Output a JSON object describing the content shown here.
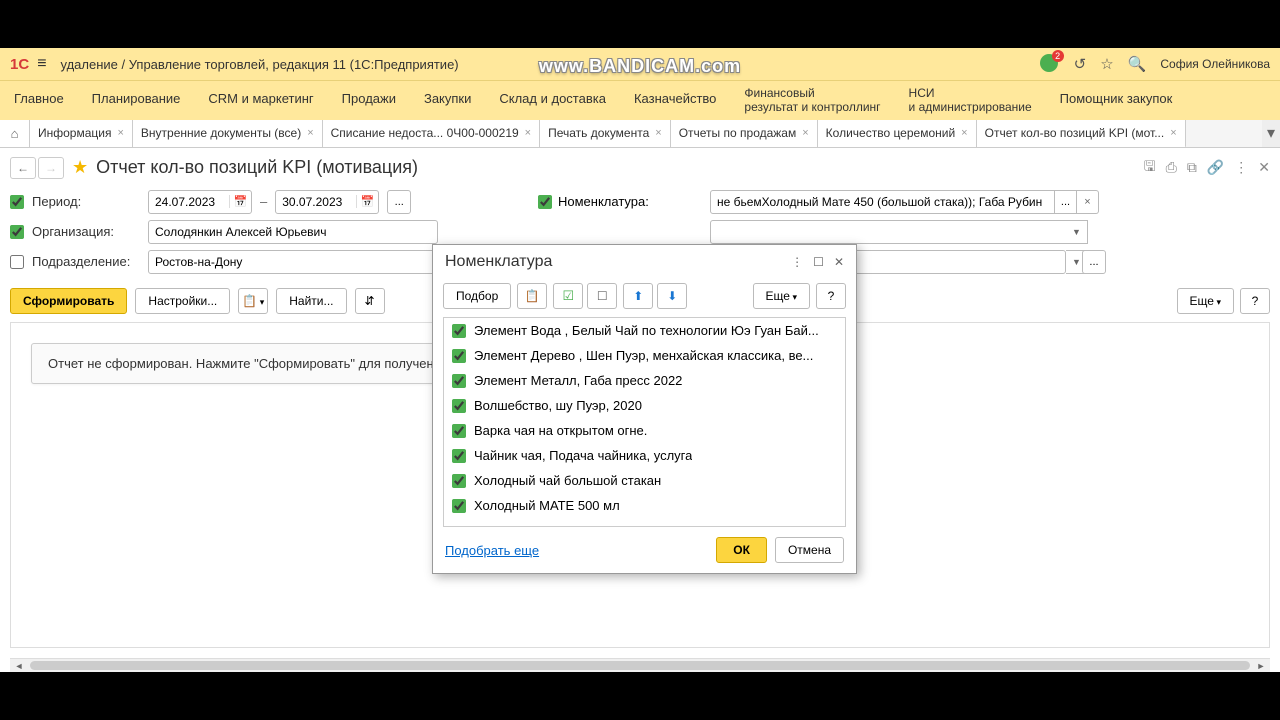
{
  "titlebar": {
    "text": "удаление / Управление торговлей, редакция 11  (1С:Предприятие)",
    "notif_count": "2",
    "user": "София Олейникова"
  },
  "watermark": "www.BANDICAM.com",
  "menu": [
    "Главное",
    "Планирование",
    "CRM и маркетинг",
    "Продажи",
    "Закупки",
    "Склад и доставка",
    "Казначейство",
    "Финансовый\nрезультат и контроллинг",
    "НСИ\nи администрирование",
    "Помощник закупок"
  ],
  "tabs": [
    {
      "label": "Информация"
    },
    {
      "label": "Внутренние документы (все)"
    },
    {
      "label": "Списание недоста... 0Ч00-000219"
    },
    {
      "label": "Печать документа"
    },
    {
      "label": "Отчеты по продажам"
    },
    {
      "label": "Количество церемоний"
    },
    {
      "label": "Отчет кол-во позиций KPI (мот...",
      "active": true
    }
  ],
  "page": {
    "title": "Отчет кол-во позиций KPI (мотивация)"
  },
  "filters": {
    "period_label": "Период:",
    "date_from": "24.07.2023",
    "date_to": "30.07.2023",
    "org_label": "Организация:",
    "org_value": "Солодянкин Алексей Юрьевич",
    "dept_label": "Подразделение:",
    "dept_value": "Ростов-на-Дону",
    "nomen_label": "Номенклатура:",
    "nomen_value": "не бьемХолодный Мате 450 (большой стака)); Габа Рубин"
  },
  "toolbar": {
    "form": "Сформировать",
    "settings": "Настройки...",
    "find": "Найти...",
    "more": "Еще",
    "q": "?"
  },
  "placeholder": "Отчет не сформирован. Нажмите \"Сформировать\" для получения",
  "dialog": {
    "title": "Номенклатура",
    "pick": "Подбор",
    "more": "Еще",
    "q": "?",
    "items": [
      "Элемент Вода , Белый Чай по технологии Юэ Гуан Бай...",
      "Элемент Дерево , Шен Пуэр, менхайская классика,  ве...",
      "Элемент Металл, Габа пресс 2022",
      "Волшебство, шу Пуэр, 2020",
      "Варка чая на открытом огне.",
      "Чайник чая, Подача чайника, услуга",
      "Холодный чай большой стакан",
      "Холодный МАТЕ 500 мл"
    ],
    "more_link": "Подобрать еще",
    "ok": "ОК",
    "cancel": "Отмена"
  }
}
